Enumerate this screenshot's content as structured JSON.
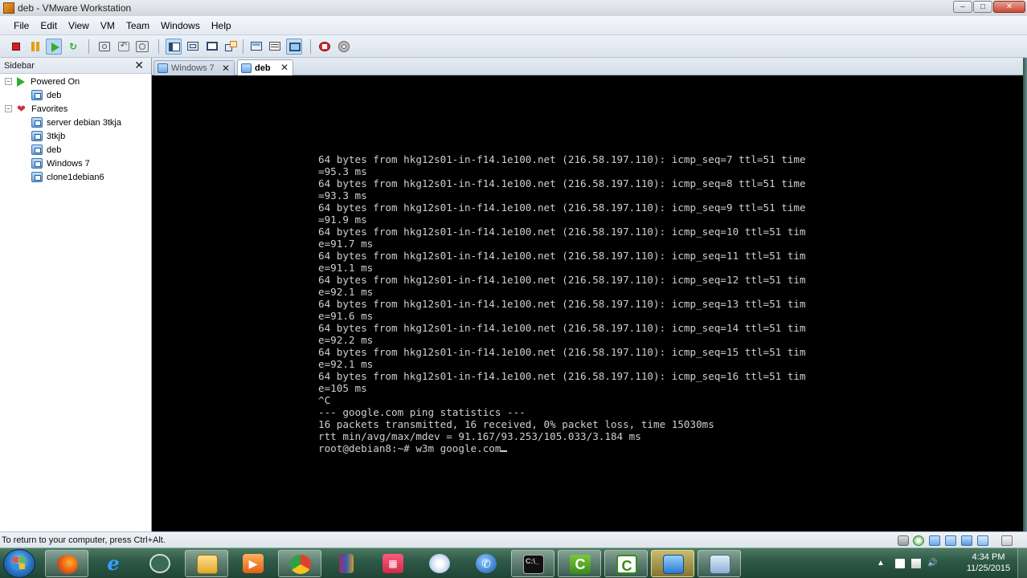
{
  "window": {
    "title": "deb - VMware Workstation",
    "buttons": {
      "minimize": "–",
      "maximize": "□",
      "close": "✕"
    }
  },
  "menu": [
    "File",
    "Edit",
    "View",
    "VM",
    "Team",
    "Windows",
    "Help"
  ],
  "toolbar": {
    "icons": [
      "power-off-icon",
      "suspend-icon",
      "power-on-icon",
      "reset-icon",
      "snapshot-icon",
      "revert-snapshot-icon",
      "snapshot-manager-icon",
      "show-sidebar-icon",
      "quick-switch-icon",
      "full-screen-icon",
      "unity-icon",
      "console-view-icon",
      "summary-view-icon",
      "thumbnail-view-icon",
      "vmware-tools-icon",
      "preferences-icon"
    ]
  },
  "sidebar": {
    "title": "Sidebar",
    "close": "✕",
    "groups": [
      {
        "label": "Powered On",
        "toggle": "−",
        "icon": "play-icon",
        "items": [
          "deb"
        ]
      },
      {
        "label": "Favorites",
        "toggle": "−",
        "icon": "heart-icon",
        "items": [
          "server debian 3tkja",
          "3tkjb",
          "deb",
          "Windows 7",
          "clone1debian6"
        ]
      }
    ]
  },
  "tabs": [
    {
      "label": "Windows 7",
      "active": false,
      "close": "✕"
    },
    {
      "label": "deb",
      "active": true,
      "close": "✕"
    }
  ],
  "console": {
    "lines": [
      "64 bytes from hkg12s01-in-f14.1e100.net (216.58.197.110): icmp_seq=7 ttl=51 time",
      "=95.3 ms",
      "64 bytes from hkg12s01-in-f14.1e100.net (216.58.197.110): icmp_seq=8 ttl=51 time",
      "=93.3 ms",
      "64 bytes from hkg12s01-in-f14.1e100.net (216.58.197.110): icmp_seq=9 ttl=51 time",
      "=91.9 ms",
      "64 bytes from hkg12s01-in-f14.1e100.net (216.58.197.110): icmp_seq=10 ttl=51 tim",
      "e=91.7 ms",
      "64 bytes from hkg12s01-in-f14.1e100.net (216.58.197.110): icmp_seq=11 ttl=51 tim",
      "e=91.1 ms",
      "64 bytes from hkg12s01-in-f14.1e100.net (216.58.197.110): icmp_seq=12 ttl=51 tim",
      "e=92.1 ms",
      "64 bytes from hkg12s01-in-f14.1e100.net (216.58.197.110): icmp_seq=13 ttl=51 tim",
      "e=91.6 ms",
      "64 bytes from hkg12s01-in-f14.1e100.net (216.58.197.110): icmp_seq=14 ttl=51 tim",
      "e=92.2 ms",
      "64 bytes from hkg12s01-in-f14.1e100.net (216.58.197.110): icmp_seq=15 ttl=51 tim",
      "e=92.1 ms",
      "64 bytes from hkg12s01-in-f14.1e100.net (216.58.197.110): icmp_seq=16 ttl=51 tim",
      "e=105 ms",
      "^C",
      "--- google.com ping statistics ---",
      "16 packets transmitted, 16 received, 0% packet loss, time 15030ms",
      "rtt min/avg/max/mdev = 91.167/93.253/105.033/3.184 ms"
    ],
    "prompt": "root@debian8:~# w3m google.com"
  },
  "statusbar": {
    "text": "To return to your computer, press Ctrl+Alt.",
    "device_icons": [
      "hard-disk-icon",
      "cd-dvd-icon",
      "network-adapter-icon",
      "usb-icon",
      "sound-card-icon",
      "printer-icon",
      "message-log-icon"
    ]
  },
  "taskbar": {
    "apps": [
      "firefox-icon",
      "internet-explorer-icon",
      "media-center-icon",
      "file-explorer-icon",
      "media-player-icon",
      "chrome-icon",
      "winrar-icon",
      "app-grid-icon",
      "paint-icon",
      "phone-icon",
      "command-prompt-icon",
      "camtasia-recorder-icon",
      "camtasia-studio-icon",
      "vmware-workstation-icon",
      "remote-desktop-icon"
    ],
    "tray_icons": [
      "show-hidden-icons-icon",
      "action-center-icon",
      "network-icon",
      "volume-icon"
    ],
    "show_hidden": "▲",
    "clock": {
      "time": "4:34 PM",
      "date": "11/25/2015"
    }
  }
}
